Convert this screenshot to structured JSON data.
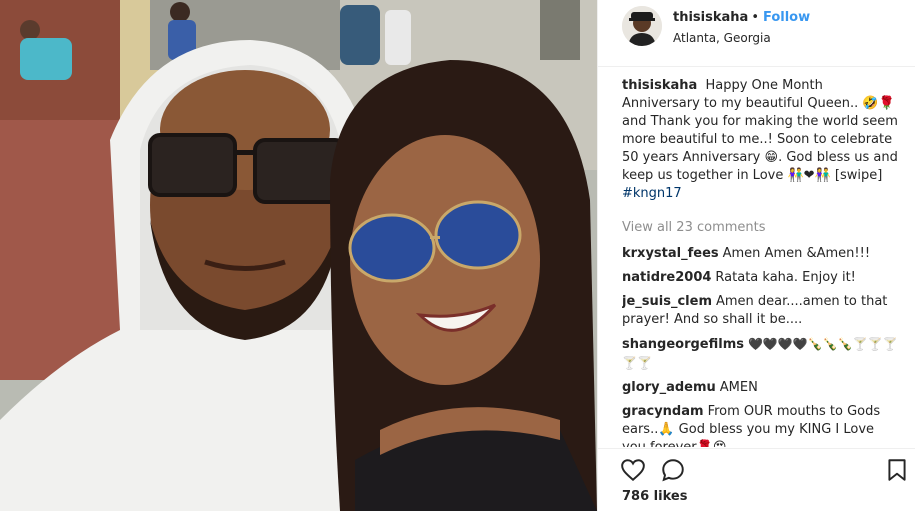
{
  "post": {
    "photo_alt": "Selfie photo",
    "header": {
      "username": "thisiskaha",
      "separator": "•",
      "follow_label": "Follow",
      "location": "Atlanta, Georgia"
    },
    "caption": {
      "username": "thisiskaha",
      "text_part1": "Happy One Month Anniversary to my beautiful Queen.. 🤣🌹 and Thank you for making the world seem more beautiful to me..! Soon to celebrate 50 years Anniversary 😁. God bless us and keep us together in Love 👫❤👫 [swipe]",
      "hashtag": "#kngn17"
    },
    "view_all_comments": "View all 23 comments",
    "comments": [
      {
        "username": "krxystal_fees",
        "text": "Amen Amen &Amen!!!"
      },
      {
        "username": "natidre2004",
        "text": "Ratata kaha. Enjoy it!"
      },
      {
        "username": "je_suis_clem",
        "text": "Amen dear....amen to that prayer! And so shall it be...."
      },
      {
        "username": "shangeorgefilms",
        "text": "🖤🖤🖤🖤🍾🍾🍾🍸🍸🍸🍸🍸"
      },
      {
        "username": "glory_ademu",
        "text": "AMEN"
      },
      {
        "username": "gracyndam",
        "text": "From OUR mouths to Gods ears..🙏 God bless you my KING I Love you forever🌹😍"
      }
    ],
    "likes": "786 likes",
    "icons": {
      "like": "heart-icon",
      "comment": "comment-bubble-icon",
      "save": "bookmark-icon"
    },
    "colors": {
      "link_blue": "#3897f0",
      "hashtag": "#003569",
      "muted": "#8e8e8e",
      "text": "#262626"
    }
  }
}
